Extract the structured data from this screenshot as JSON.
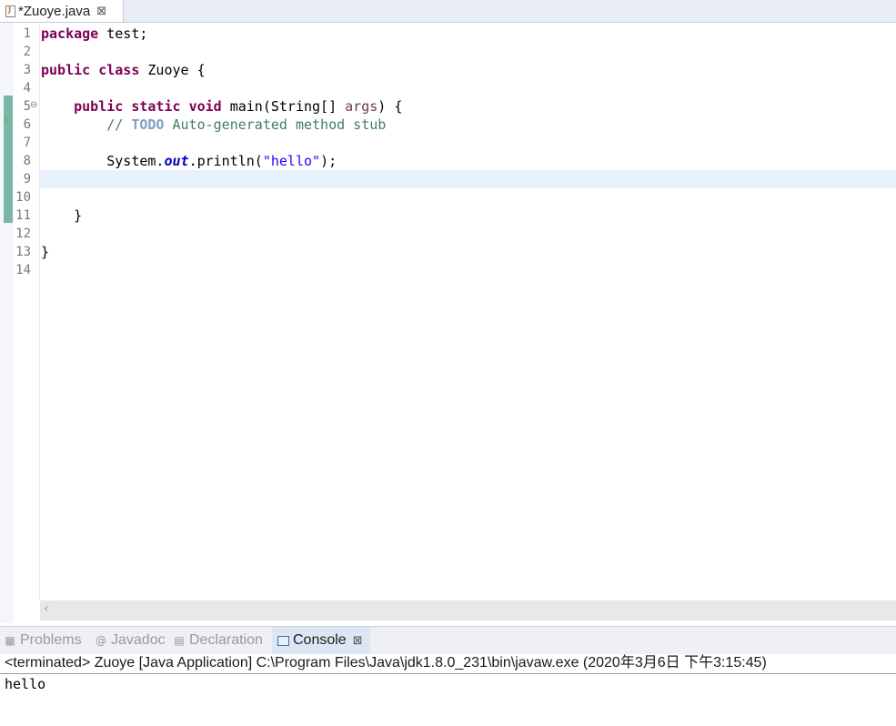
{
  "editor_tab": {
    "label": "*Zuoye.java",
    "close_glyph": "⊠"
  },
  "line_numbers": [
    "1",
    "2",
    "3",
    "4",
    "5",
    "6",
    "7",
    "8",
    "9",
    "10",
    "11",
    "12",
    "13",
    "14"
  ],
  "code": {
    "l1_kw": "package",
    "l1_rest": " test;",
    "l3_kw1": "public",
    "l3_kw2": "class",
    "l3_rest": " Zuoye {",
    "l5_indent": "    ",
    "l5_kw1": "public",
    "l5_kw2": "static",
    "l5_kw3": "void",
    "l5_sig": " main(String[] ",
    "l5_param": "args",
    "l5_end": ") {",
    "l6_indent": "        ",
    "l6_comment": "// ",
    "l6_todo": "TODO",
    "l6_rest": " Auto-generated method stub",
    "l8_indent": "        ",
    "l8_a": "System.",
    "l8_field": "out",
    "l8_b": ".println(",
    "l8_str": "\"hello\"",
    "l8_c": ");",
    "l11": "    }",
    "l13": "}"
  },
  "current_line": 9,
  "panel_tabs": {
    "problems": "Problems",
    "javadoc": "Javadoc",
    "declaration": "Declaration",
    "console": "Console",
    "console_close": "⊠"
  },
  "console": {
    "header": "<terminated> Zuoye [Java Application] C:\\Program Files\\Java\\jdk1.8.0_231\\bin\\javaw.exe (2020年3月6日 下午3:15:45)",
    "output": "hello"
  },
  "colors": {
    "keyword": "#7f0055",
    "comment": "#3f7f5f",
    "string": "#2a00ff",
    "field": "#0000c0",
    "current_line": "#e8f2fe"
  }
}
